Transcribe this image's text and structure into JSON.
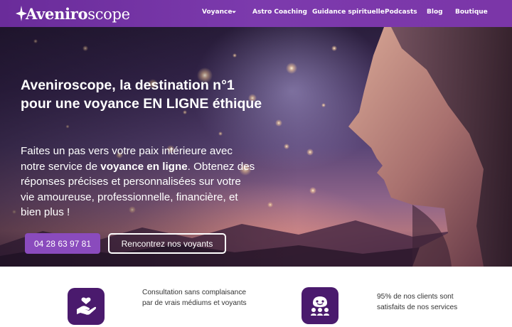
{
  "brand": {
    "logo_bold": "Aveniro",
    "logo_light": "scope"
  },
  "nav": {
    "items": [
      {
        "label": "Voyance",
        "has_dropdown": true
      },
      {
        "label": "Astro Coaching"
      },
      {
        "label": "Guidance spirituelle"
      },
      {
        "label": "Podcasts"
      },
      {
        "label": "Blog"
      },
      {
        "label": "Boutique"
      }
    ]
  },
  "hero": {
    "title": "Aveniroscope, la destination n°1 pour une voyance EN LIGNE éthique",
    "text_before": "Faites un pas vers votre paix intérieure avec notre service de ",
    "text_bold": "voyance en ligne",
    "text_after": ". Obtenez des réponses précises et personnalisées sur votre vie amoureuse, professionnelle, financière, et bien plus !",
    "phone_button": "04 28 63 97 81",
    "cta_button": "Rencontrez nos voyants"
  },
  "features": [
    {
      "icon": "hand-heart-icon",
      "text": "Consultation sans complaisance par de vrais médiums et voyants"
    },
    {
      "icon": "satisfied-clients-icon",
      "text": "95% de nos clients sont satisfaits de nos services"
    }
  ],
  "colors": {
    "header": "#7c3aad",
    "button_primary": "#8a4bbd",
    "icon_bg": "#4a1a6d"
  }
}
